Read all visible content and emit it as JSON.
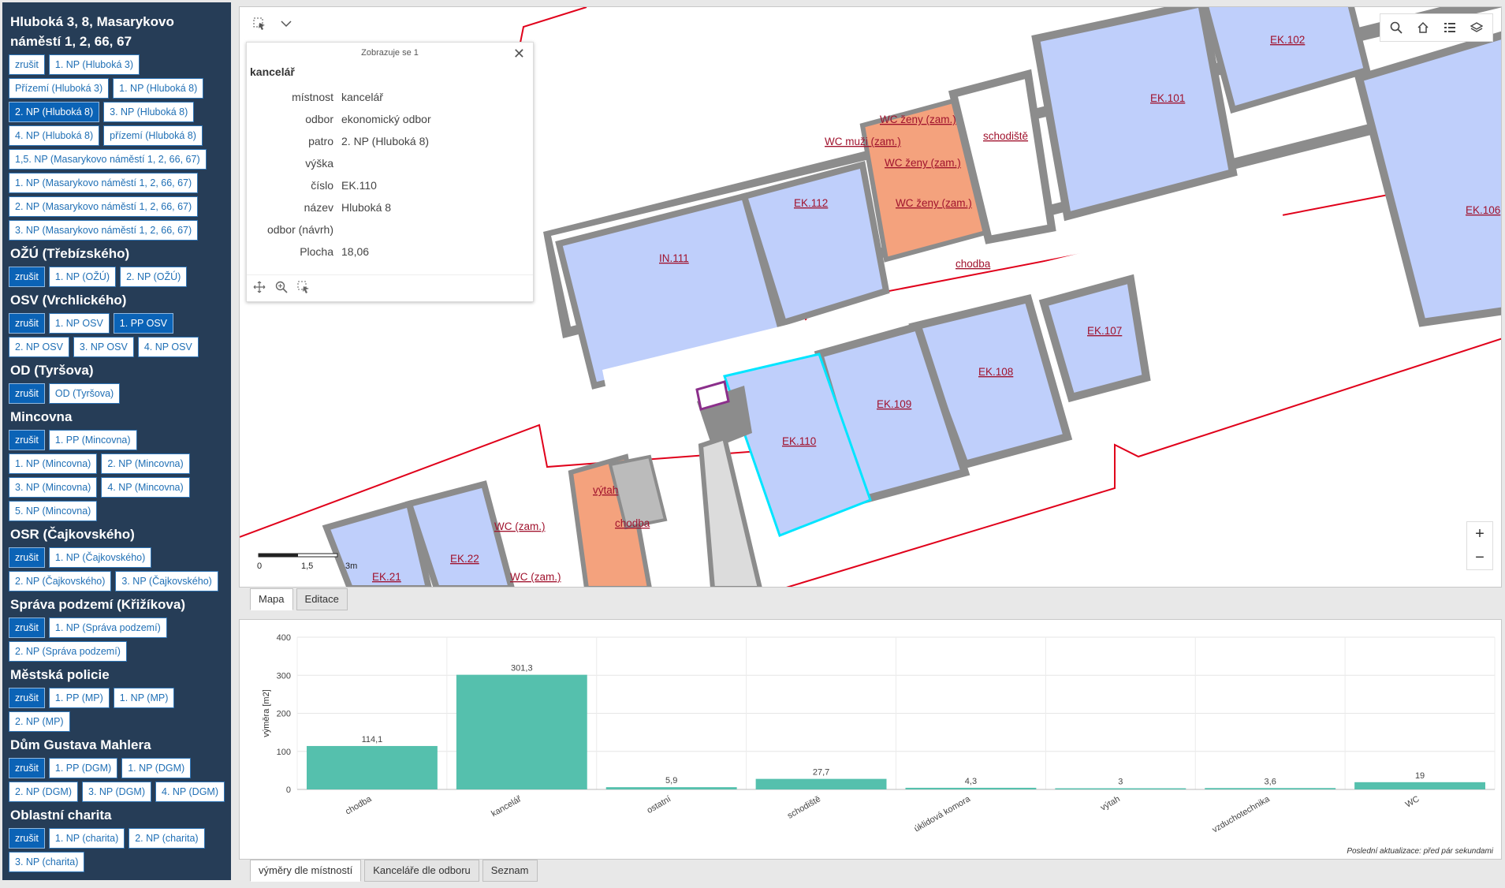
{
  "sidebar": {
    "groups": [
      {
        "title": "Hluboká 3, 8, Masarykovo náměstí 1, 2, 66, 67",
        "buttons": [
          {
            "label": "zrušit",
            "active": false
          },
          {
            "label": "1. NP (Hluboká 3)",
            "active": false
          },
          {
            "label": "Přízemí (Hluboká 3)",
            "active": false
          },
          {
            "label": "1. NP (Hluboká 8)",
            "active": false
          },
          {
            "label": "2. NP (Hluboká 8)",
            "active": true
          },
          {
            "label": "3. NP (Hluboká 8)",
            "active": false
          },
          {
            "label": "4. NP (Hluboká 8)",
            "active": false
          },
          {
            "label": "přízemí (Hluboká 8)",
            "active": false
          },
          {
            "label": "1,5. NP (Masarykovo náměstí 1, 2, 66, 67)",
            "active": false
          },
          {
            "label": "1. NP (Masarykovo náměstí 1, 2, 66, 67)",
            "active": false
          },
          {
            "label": "2. NP (Masarykovo náměstí 1, 2, 66, 67)",
            "active": false
          },
          {
            "label": "3. NP (Masarykovo náměstí 1, 2, 66, 67)",
            "active": false
          }
        ]
      },
      {
        "title": "OŽÚ (Třebízského)",
        "buttons": [
          {
            "label": "zrušit",
            "active": true
          },
          {
            "label": "1. NP (OŽÚ)",
            "active": false
          },
          {
            "label": "2. NP (OŽÚ)",
            "active": false
          }
        ]
      },
      {
        "title": "OSV (Vrchlického)",
        "buttons": [
          {
            "label": "zrušit",
            "active": true
          },
          {
            "label": "1. NP OSV",
            "active": false
          },
          {
            "label": "1. PP OSV",
            "active": true
          },
          {
            "label": "2. NP OSV",
            "active": false
          },
          {
            "label": "3. NP OSV",
            "active": false
          },
          {
            "label": "4. NP OSV",
            "active": false
          }
        ]
      },
      {
        "title": "OD (Tyršova)",
        "buttons": [
          {
            "label": "zrušit",
            "active": true
          },
          {
            "label": "OD (Tyršova)",
            "active": false
          }
        ]
      },
      {
        "title": "Mincovna",
        "buttons": [
          {
            "label": "zrušit",
            "active": true
          },
          {
            "label": "1. PP (Mincovna)",
            "active": false
          },
          {
            "label": "1. NP (Mincovna)",
            "active": false
          },
          {
            "label": "2. NP (Mincovna)",
            "active": false
          },
          {
            "label": "3. NP (Mincovna)",
            "active": false
          },
          {
            "label": "4. NP (Mincovna)",
            "active": false
          },
          {
            "label": "5. NP (Mincovna)",
            "active": false
          }
        ]
      },
      {
        "title": "OSR (Čajkovského)",
        "buttons": [
          {
            "label": "zrušit",
            "active": true
          },
          {
            "label": "1. NP (Čajkovského)",
            "active": false
          },
          {
            "label": "2. NP (Čajkovského)",
            "active": false
          },
          {
            "label": "3. NP (Čajkovského)",
            "active": false
          }
        ]
      },
      {
        "title": "Správa podzemí (Křižíkova)",
        "buttons": [
          {
            "label": "zrušit",
            "active": true
          },
          {
            "label": "1. NP (Správa podzemí)",
            "active": false
          },
          {
            "label": "2. NP (Správa podzemí)",
            "active": false
          }
        ]
      },
      {
        "title": "Městská policie",
        "buttons": [
          {
            "label": "zrušit",
            "active": true
          },
          {
            "label": "1. PP (MP)",
            "active": false
          },
          {
            "label": "1. NP (MP)",
            "active": false
          },
          {
            "label": "2. NP (MP)",
            "active": false
          }
        ]
      },
      {
        "title": "Dům Gustava Mahlera",
        "buttons": [
          {
            "label": "zrušit",
            "active": true
          },
          {
            "label": "1. PP (DGM)",
            "active": false
          },
          {
            "label": "1. NP (DGM)",
            "active": false
          },
          {
            "label": "2. NP (DGM)",
            "active": false
          },
          {
            "label": "3. NP (DGM)",
            "active": false
          },
          {
            "label": "4. NP (DGM)",
            "active": false
          }
        ]
      },
      {
        "title": "Oblastní charita",
        "buttons": [
          {
            "label": "zrušit",
            "active": true
          },
          {
            "label": "1. NP (charita)",
            "active": false
          },
          {
            "label": "2. NP (charita)",
            "active": false
          },
          {
            "label": "3. NP (charita)",
            "active": false
          }
        ]
      }
    ]
  },
  "map": {
    "tools": {
      "select_icon": "select-icon",
      "dropdown_icon": "chevron-down-icon"
    },
    "right_tools": [
      "search-icon",
      "home-icon",
      "legend-icon",
      "layers-icon"
    ],
    "zoom_in": "+",
    "zoom_out": "−",
    "scale": {
      "zero": "0",
      "mid": "1,5",
      "end": "3m"
    },
    "room_labels": {
      "ek102": "EK.102",
      "ek101": "EK.101",
      "ek106": "EK.106",
      "wcz1": "WC ženy (zam.)",
      "wcm": "WC muži (zam.)",
      "wcz2": "WC ženy (zam.)",
      "wcz3": "WC ženy (zam.)",
      "schodiste": "schodiště",
      "ek112": "EK.112",
      "in111": "IN.111",
      "chodba1": "chodba",
      "ek107": "EK.107",
      "ek108": "EK.108",
      "ek109": "EK.109",
      "ek110": "EK.110",
      "vytah": "výtah",
      "chodba2": "chodba",
      "wc1": "WC (zam.)",
      "wc2": "WC (zam.)",
      "ek22": "EK.22",
      "ek21": "EK.21"
    },
    "colors": {
      "office": "#bfcffb",
      "wc": "#f4a27d",
      "wall": "#8c8c8c",
      "boundary": "#e0001a",
      "selected": "#00e5ff"
    }
  },
  "popup": {
    "header": "Zobrazuje se 1",
    "title": "kancelář",
    "fields": [
      {
        "key": "místnost",
        "value": "kancelář"
      },
      {
        "key": "odbor",
        "value": "ekonomický odbor"
      },
      {
        "key": "patro",
        "value": "2. NP (Hluboká 8)"
      },
      {
        "key": "výška",
        "value": ""
      },
      {
        "key": "číslo",
        "value": "EK.110"
      },
      {
        "key": "název",
        "value": "Hluboká 8"
      },
      {
        "key": "odbor (návrh)",
        "value": ""
      },
      {
        "key": "Plocha",
        "value": "18,06"
      }
    ]
  },
  "map_tabs": [
    {
      "label": "Mapa",
      "active": true
    },
    {
      "label": "Editace",
      "active": false
    }
  ],
  "chart_data": {
    "type": "bar",
    "categories": [
      "chodba",
      "kancelář",
      "ostatní",
      "schodiště",
      "úklidová komora",
      "výtah",
      "vzduchotechnika",
      "WC"
    ],
    "values": [
      114.1,
      301.3,
      5.9,
      27.7,
      4.3,
      3,
      3.6,
      19
    ],
    "value_labels": [
      "114,1",
      "301,3",
      "5,9",
      "27,7",
      "4,3",
      "3",
      "3,6",
      "19"
    ],
    "ylabel": "výměra [m2]",
    "xlabel": "",
    "ylim": [
      0,
      400
    ],
    "yticks": [
      "0",
      "100",
      "200",
      "300",
      "400"
    ],
    "grid": true,
    "color": "#55c0ad"
  },
  "chart_updated": "Poslední aktualizace: před pár sekundami",
  "chart_tabs": [
    {
      "label": "výměry dle místností",
      "active": true
    },
    {
      "label": "Kanceláře dle odboru",
      "active": false
    },
    {
      "label": "Seznam",
      "active": false
    }
  ]
}
